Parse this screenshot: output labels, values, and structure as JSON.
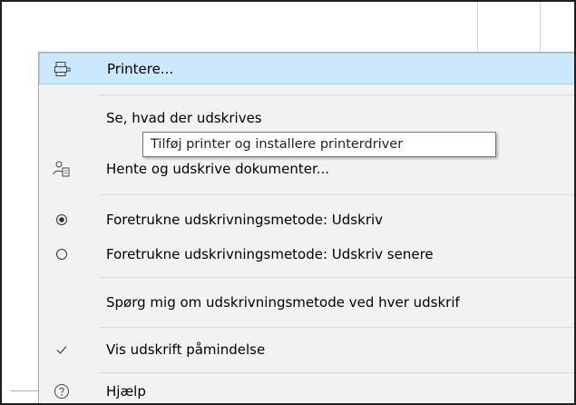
{
  "menu": {
    "items": [
      {
        "label": "Printere...",
        "icon": "printer-icon"
      },
      {
        "label": "Se, hvad der udskrives"
      },
      {
        "label": "Hente og udskrive dokumenter...",
        "icon": "user-document-icon"
      },
      {
        "label": "Foretrukne udskrivningsmetode: Udskriv",
        "icon": "radio-selected-icon"
      },
      {
        "label": "Foretrukne udskrivningsmetode: Udskriv senere",
        "icon": "radio-empty-icon"
      },
      {
        "label": "Spørg mig om udskrivningsmetode ved hver udskrif"
      },
      {
        "label": "Vis udskrift påmindelse",
        "icon": "checkmark-icon"
      },
      {
        "label": "Hjælp",
        "icon": "help-icon"
      }
    ]
  },
  "tooltip": {
    "text": "Tilføj printer og installere printerdriver"
  },
  "colors": {
    "highlight": "#cce8ff",
    "highlight_border": "#99d1ff",
    "menu_bg": "#f2f2f2"
  }
}
